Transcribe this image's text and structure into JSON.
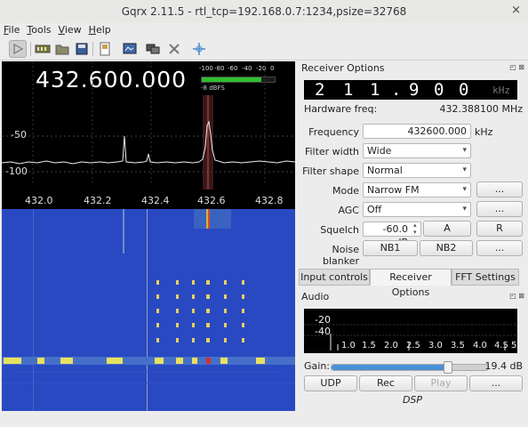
{
  "window": {
    "title": "Gqrx 2.11.5 - rtl_tcp=192.168.0.7:1234,psize=32768",
    "close": "×"
  },
  "menu": [
    "File",
    "Tools",
    "View",
    "Help"
  ],
  "toolbar_icons": [
    "play-icon",
    "device-icon",
    "open-folder-icon",
    "save-icon",
    "record-icon",
    "screenshot-icon",
    "remote-icon",
    "tools-icon",
    "move-icon"
  ],
  "spectrum": {
    "frequency": "432.600.000",
    "smeter_ticks": [
      "-100",
      "-80",
      "-60",
      "-40",
      "-20",
      "0"
    ],
    "smeter_dbfs": "-8 dBFS",
    "smeter_level": 0.82,
    "y_ticks": [
      "-50",
      "-100"
    ],
    "x_ticks": [
      "432.0",
      "432.2",
      "432.4",
      "432.6",
      "432.8"
    ]
  },
  "receiver": {
    "header": "Receiver Options",
    "lcd_digits": [
      "2",
      "1",
      "1",
      ".",
      "9",
      "0",
      "0"
    ],
    "lcd_unit": "kHz",
    "hw_label": "Hardware freq:",
    "hw_value": "432.388100 MHz",
    "frequency_label": "Frequency",
    "frequency_value": "432600.000",
    "frequency_unit": "kHz",
    "filter_width_label": "Filter width",
    "filter_width_value": "Wide",
    "filter_shape_label": "Filter shape",
    "filter_shape_value": "Normal",
    "mode_label": "Mode",
    "mode_value": "Narrow FM",
    "mode_more": "...",
    "agc_label": "AGC",
    "agc_value": "Off",
    "agc_more": "...",
    "squelch_label": "Squelch",
    "squelch_value": "-60.0 dB",
    "squelch_a": "A",
    "squelch_r": "R",
    "nb_label": "Noise blanker",
    "nb1": "NB1",
    "nb2": "NB2",
    "nb_more": "..."
  },
  "tabs": [
    "Input controls",
    "Receiver Options",
    "FFT Settings"
  ],
  "audio": {
    "header": "Audio",
    "y_ticks": [
      "-20",
      "-40"
    ],
    "x_ticks": [
      "1.0",
      "1.5",
      "2.0",
      "2.5",
      "3.0",
      "3.5",
      "4.0",
      "4.5",
      "5"
    ],
    "gain_label": "Gain:",
    "gain_value": "19.4 dB",
    "gain_level": 0.74,
    "udp": "UDP",
    "rec": "Rec",
    "play": "Play",
    "more": "...",
    "dsp": "DSP"
  },
  "colors": {
    "waterfall_bg": "#2949c2",
    "signal": "#e8e8e8",
    "lcd_bg": "#000000"
  }
}
